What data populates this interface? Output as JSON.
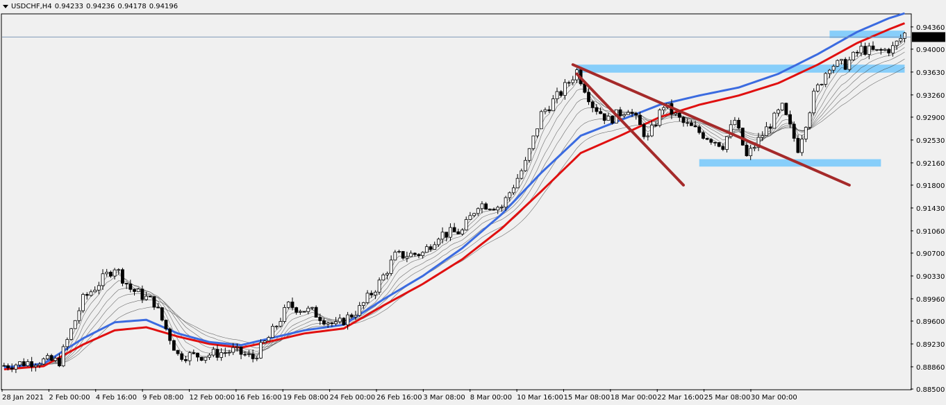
{
  "header": {
    "symbol_tf": "USDCHF,H4",
    "open": "0.94233",
    "high": "0.94236",
    "low": "0.94178",
    "close": "0.94196"
  },
  "colors": {
    "background": "#f0f0f0",
    "bull_candle": "#ffffff",
    "bear_candle": "#000000",
    "ma_red": "#e01010",
    "ma_blue": "#3b6be0",
    "ma_thin": "#404040",
    "trendline": "#a52a2a",
    "zone": "#87cefa",
    "price_line": "#7f9ab8"
  },
  "chart_data": {
    "type": "candlestick",
    "symbol": "USDCHF",
    "timeframe": "H4",
    "ylim": [
      0.885,
      0.9456
    ],
    "y_ticks": [
      "0.94360",
      "0.94000",
      "0.93630",
      "0.93260",
      "0.92900",
      "0.92530",
      "0.92160",
      "0.91800",
      "0.91430",
      "0.91060",
      "0.90700",
      "0.90330",
      "0.89960",
      "0.89600",
      "0.89230",
      "0.88860",
      "0.88500"
    ],
    "current_price": "0.94196",
    "x_ticks": [
      "28 Jan 2021",
      "2 Feb 00:00",
      "4 Feb 16:00",
      "9 Feb 08:00",
      "12 Feb 00:00",
      "16 Feb 16:00",
      "19 Feb 08:00",
      "24 Feb 00:00",
      "26 Feb 16:00",
      "3 Mar 08:00",
      "8 Mar 00:00",
      "10 Mar 16:00",
      "15 Mar 08:00",
      "18 Mar 00:00",
      "22 Mar 16:00",
      "25 Mar 08:00",
      "30 Mar 00:00"
    ],
    "price_path": [
      [
        0,
        0.8888
      ],
      [
        9,
        0.8896
      ],
      [
        14,
        0.8895
      ],
      [
        20,
        0.8995
      ],
      [
        28,
        0.9048
      ],
      [
        32,
        0.9012
      ],
      [
        38,
        0.899
      ],
      [
        44,
        0.8905
      ],
      [
        50,
        0.8904
      ],
      [
        58,
        0.8912
      ],
      [
        63,
        0.89
      ],
      [
        67,
        0.8933
      ],
      [
        72,
        0.8985
      ],
      [
        78,
        0.8975
      ],
      [
        84,
        0.8952
      ],
      [
        90,
        0.898
      ],
      [
        95,
        0.9022
      ],
      [
        99,
        0.9065
      ],
      [
        106,
        0.907
      ],
      [
        110,
        0.91
      ],
      [
        116,
        0.9105
      ],
      [
        120,
        0.915
      ],
      [
        126,
        0.9145
      ],
      [
        132,
        0.9215
      ],
      [
        136,
        0.9295
      ],
      [
        141,
        0.933
      ],
      [
        145,
        0.9365
      ],
      [
        149,
        0.931
      ],
      [
        153,
        0.9285
      ],
      [
        158,
        0.9305
      ],
      [
        163,
        0.9255
      ],
      [
        167,
        0.931
      ],
      [
        172,
        0.928
      ],
      [
        177,
        0.9262
      ],
      [
        182,
        0.9245
      ],
      [
        185,
        0.9285
      ],
      [
        188,
        0.9225
      ],
      [
        192,
        0.9262
      ],
      [
        197,
        0.9305
      ],
      [
        201,
        0.924
      ],
      [
        205,
        0.9325
      ],
      [
        209,
        0.9375
      ],
      [
        213,
        0.9375
      ],
      [
        217,
        0.94
      ],
      [
        221,
        0.9395
      ],
      [
        225,
        0.9402
      ],
      [
        228,
        0.9425
      ]
    ],
    "moving_averages": [
      {
        "color": "red",
        "path": [
          [
            0,
            0.8882
          ],
          [
            10,
            0.8887
          ],
          [
            20,
            0.8922
          ],
          [
            28,
            0.8945
          ],
          [
            36,
            0.895
          ],
          [
            44,
            0.8935
          ],
          [
            52,
            0.8923
          ],
          [
            60,
            0.8917
          ],
          [
            66,
            0.8925
          ],
          [
            76,
            0.894
          ],
          [
            86,
            0.8948
          ],
          [
            96,
            0.8985
          ],
          [
            106,
            0.902
          ],
          [
            116,
            0.906
          ],
          [
            126,
            0.911
          ],
          [
            136,
            0.917
          ],
          [
            146,
            0.9232
          ],
          [
            156,
            0.926
          ],
          [
            166,
            0.929
          ],
          [
            176,
            0.931
          ],
          [
            186,
            0.9325
          ],
          [
            196,
            0.9345
          ],
          [
            206,
            0.9375
          ],
          [
            216,
            0.941
          ],
          [
            224,
            0.9432
          ],
          [
            228,
            0.9442
          ]
        ]
      },
      {
        "color": "blue",
        "path": [
          [
            0,
            0.8885
          ],
          [
            10,
            0.8891
          ],
          [
            20,
            0.8932
          ],
          [
            28,
            0.8958
          ],
          [
            36,
            0.8962
          ],
          [
            44,
            0.894
          ],
          [
            52,
            0.8926
          ],
          [
            60,
            0.8921
          ],
          [
            66,
            0.893
          ],
          [
            76,
            0.8945
          ],
          [
            86,
            0.8954
          ],
          [
            96,
            0.8995
          ],
          [
            106,
            0.9033
          ],
          [
            116,
            0.9078
          ],
          [
            126,
            0.9133
          ],
          [
            136,
            0.92
          ],
          [
            146,
            0.926
          ],
          [
            156,
            0.9285
          ],
          [
            166,
            0.931
          ],
          [
            176,
            0.9325
          ],
          [
            186,
            0.9338
          ],
          [
            196,
            0.936
          ],
          [
            206,
            0.9392
          ],
          [
            216,
            0.9428
          ],
          [
            224,
            0.945
          ],
          [
            228,
            0.9458
          ]
        ]
      }
    ],
    "trendlines": [
      {
        "from": [
          144,
          0.9375
        ],
        "to": [
          214,
          0.918
        ]
      },
      {
        "from": [
          145,
          0.936
        ],
        "to": [
          172,
          0.918
        ]
      }
    ],
    "zones": [
      {
        "from_x": 209,
        "to_x": 228,
        "y_top": 0.943,
        "y_bottom": 0.9418
      },
      {
        "from_x": 145,
        "to_x": 228,
        "y_top": 0.9375,
        "y_bottom": 0.9362
      },
      {
        "from_x": 176,
        "to_x": 222,
        "y_top": 0.9222,
        "y_bottom": 0.921
      }
    ]
  }
}
